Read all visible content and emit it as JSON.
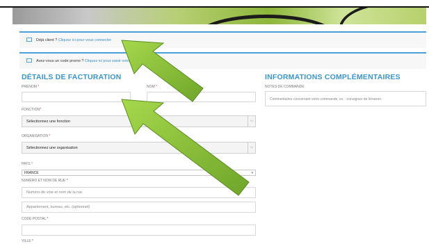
{
  "login_notice": {
    "prefix": "Déjà client ?",
    "link": "Cliquez ici pour vous connecter"
  },
  "promo_notice": {
    "prefix": "Avez-vous un code promo ?",
    "link": "Cliquez ici pour saisir votre code"
  },
  "billing": {
    "title": "DÉTAILS DE FACTURATION",
    "prenom_label": "PRÉNOM",
    "nom_label": "NOM",
    "fonction_label": "FONCTION",
    "fonction_value": "Sélectionnez une fonction",
    "organisation_label": "ORGANISATION",
    "organisation_value": "Sélectionnez une organisation",
    "pays_label": "PAYS",
    "pays_value": "FRANCE",
    "rue_label": "NUMÉRO ET NOM DE RUE",
    "rue_placeholder": "Numéro de voie et nom de la rue",
    "appt_placeholder": "Appartement, bureau, etc. (optionnel)",
    "cp_label": "CODE POSTAL",
    "ville_label": "VILLE",
    "required_mark": "*"
  },
  "additional": {
    "title": "INFORMATIONS COMPLÉMENTAIRES",
    "notes_label": "NOTES DE COMMANDE",
    "notes_placeholder": "Commentaires concernant votre commande, ex. : consignes de livraison."
  },
  "icons": {
    "notice_icon": "window-icon",
    "select_icon": "chevron-down-icon"
  },
  "colors": {
    "accent": "#3b95cc",
    "arrow": "#8cc63f",
    "required": "#dd3333"
  }
}
